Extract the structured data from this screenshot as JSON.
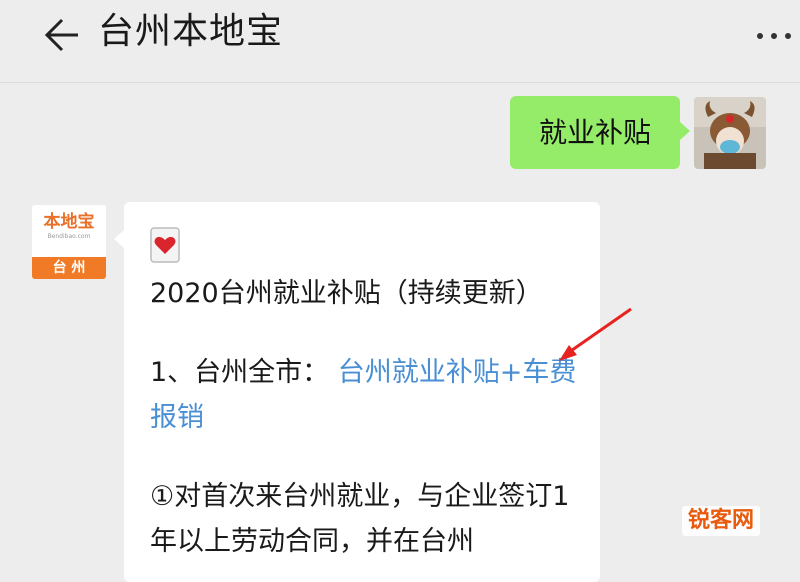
{
  "header": {
    "title": "台州本地宝"
  },
  "chat": {
    "my_message": "就业补贴",
    "bot_avatar_logo": "本地宝",
    "bot_avatar_sub": "Bendibao.com",
    "bot_avatar_city": "台 州",
    "reply_title": "2020台州就业补贴（持续更新）",
    "reply_item_prefix": "1、台州全市：",
    "reply_item_link": "台州就业补贴+车费报销",
    "reply_para": "①对首次来台州就业，与企业签订1年以上劳动合同，并在台州"
  },
  "watermark": "锐客网",
  "colors": {
    "background": "#ededed",
    "my_bubble": "#95ec69",
    "link": "#4a8fd3",
    "arrow": "#e8231f",
    "brand_orange": "#f07a25"
  }
}
